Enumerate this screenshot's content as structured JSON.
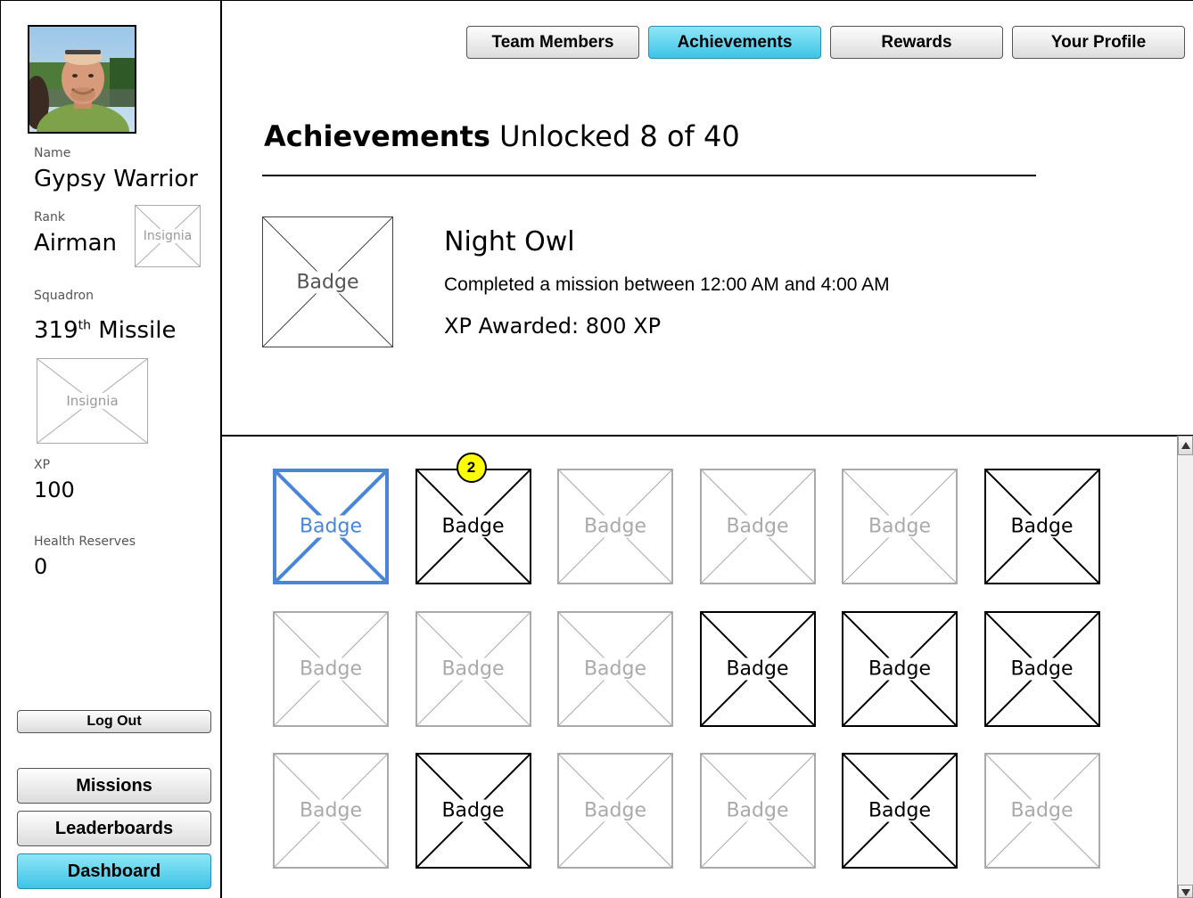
{
  "top_nav": {
    "team_members": "Team Members",
    "achievements": "Achievements",
    "rewards": "Rewards",
    "your_profile": "Your Profile",
    "active_tab": "Achievements",
    "active_color": "#3ec4e6"
  },
  "profile": {
    "name_label": "Name",
    "name": "Gypsy Warrior",
    "rank_label": "Rank",
    "rank": "Airman",
    "rank_insignia": "Insignia",
    "squadron_label": "Squadron",
    "squadron_number": "319",
    "squadron_suffix": "th",
    "squadron_name": "Missile",
    "squadron_insignia": "Insignia",
    "xp_label": "XP",
    "xp": "100",
    "health_label": "Health Reserves",
    "health": "0"
  },
  "sidebar_buttons": {
    "logout": "Log Out",
    "missions": "Missions",
    "leaderboards": "Leaderboards",
    "dashboard": "Dashboard"
  },
  "header": {
    "title": "Achievements",
    "subtitle": "Unlocked 8 of 40"
  },
  "selected_achievement": {
    "badge_label": "Badge",
    "name": "Night Owl",
    "description": "Completed a mission between 12:00 AM and 4:00 AM",
    "xp_awarded": "XP Awarded: 800 XP"
  },
  "badges": [
    {
      "label": "Badge",
      "state": "selected"
    },
    {
      "label": "Badge",
      "state": "unlocked",
      "count": "2"
    },
    {
      "label": "Badge",
      "state": "locked"
    },
    {
      "label": "Badge",
      "state": "locked"
    },
    {
      "label": "Badge",
      "state": "locked"
    },
    {
      "label": "Badge",
      "state": "unlocked"
    },
    {
      "label": "Badge",
      "state": "locked"
    },
    {
      "label": "Badge",
      "state": "locked"
    },
    {
      "label": "Badge",
      "state": "locked"
    },
    {
      "label": "Badge",
      "state": "unlocked"
    },
    {
      "label": "Badge",
      "state": "unlocked"
    },
    {
      "label": "Badge",
      "state": "unlocked"
    },
    {
      "label": "Badge",
      "state": "locked"
    },
    {
      "label": "Badge",
      "state": "unlocked"
    },
    {
      "label": "Badge",
      "state": "locked"
    },
    {
      "label": "Badge",
      "state": "locked"
    },
    {
      "label": "Badge",
      "state": "unlocked"
    },
    {
      "label": "Badge",
      "state": "locked"
    }
  ]
}
